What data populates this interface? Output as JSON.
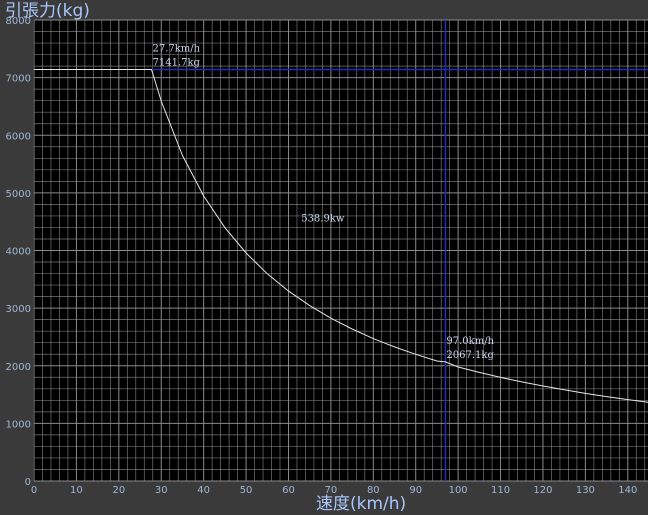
{
  "chart_data": {
    "type": "line",
    "ylabel": "引張力(kg)",
    "xlabel": "速度(km/h)",
    "xlim": [
      0,
      145
    ],
    "ylim": [
      0,
      8000
    ],
    "x_ticks": [
      0,
      10,
      20,
      30,
      40,
      50,
      60,
      70,
      80,
      90,
      100,
      110,
      120,
      130,
      140
    ],
    "y_ticks": [
      0,
      1000,
      2000,
      3000,
      4000,
      5000,
      6000,
      7000,
      8000
    ],
    "grid": true,
    "series": [
      {
        "x": [
          0,
          27.7,
          30,
          35,
          40,
          45,
          50,
          55,
          60,
          65,
          70,
          75,
          80,
          85,
          90,
          95,
          97,
          100,
          105,
          110,
          115,
          120,
          125,
          130,
          135,
          140,
          145
        ],
        "y": [
          7141.7,
          7141.7,
          6594,
          5651,
          4945,
          4395,
          3956,
          3596,
          3296,
          3043,
          2826,
          2637,
          2472,
          2327,
          2198,
          2082,
          2067.1,
          1978,
          1884,
          1798,
          1720,
          1648,
          1582,
          1521,
          1465,
          1413,
          1364
        ]
      }
    ],
    "crosshairs": [
      {
        "x": 27.7,
        "y": 7141.7,
        "label_speed": "27.7km/h",
        "label_force": "7141.7kg"
      },
      {
        "x": 97.0,
        "y": 2067.1,
        "label_speed": "97.0km/h",
        "label_force": "2067.1kg"
      }
    ],
    "power_annotation": {
      "text": "538.9kw",
      "x": 63,
      "y": 4500
    },
    "colors": {
      "background": "#000000",
      "grid": "#8a8a8a",
      "curve": "#e6e6e6",
      "crosshair": "#1f2fb8",
      "frame": "#3a3a3a",
      "axis_text": "#9eb6d6",
      "title_text": "#a9c7ff"
    }
  }
}
